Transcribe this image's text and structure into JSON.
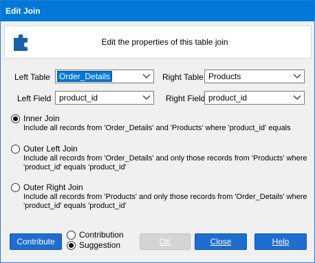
{
  "window": {
    "title": "Edit Join"
  },
  "header": {
    "text": "Edit the properties of this table join",
    "icon": "puzzle-icon",
    "icon_color": "#1a5fa8"
  },
  "left_table": {
    "label": "Left Table",
    "value": "Order_Details"
  },
  "right_table": {
    "label": "Right Table",
    "value": "Products"
  },
  "left_field": {
    "label": "Left Field",
    "value": "product_id"
  },
  "right_field": {
    "label": "Right Field",
    "value": "product_id"
  },
  "join_types": [
    {
      "label": "Inner Join",
      "description": "Include all records from 'Order_Details' and 'Products' where 'product_id' equals",
      "selected": true
    },
    {
      "label": "Outer Left Join",
      "description": "Include all records from 'Order_Details' and only those records from 'Products' where 'product_id' equals 'product_id'",
      "selected": false
    },
    {
      "label": "Outer Right Join",
      "description": "Include all records from 'Products' and only those records from 'Order_Details' where 'product_id' equals 'product_id'",
      "selected": false
    }
  ],
  "footer": {
    "contribute_label": "Contribute",
    "contribution_label": "Contribution",
    "suggestion_label": "Suggestion",
    "suggestion_selected": true,
    "ok_label": "OK",
    "close_label": "Close",
    "help_label": "Help"
  },
  "colors": {
    "accent": "#0078d7",
    "button": "#1e6dcf",
    "disabled": "#d4d4d4"
  }
}
